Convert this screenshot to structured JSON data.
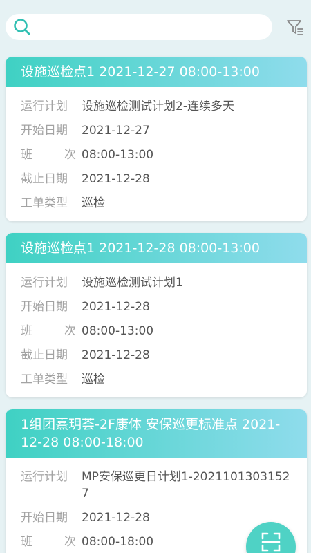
{
  "search": {
    "placeholder": "",
    "value": ""
  },
  "icons": {
    "search": "search-icon",
    "filter": "filter-icon",
    "scan": "scan-icon"
  },
  "colors": {
    "accent": "#3fd1c3",
    "accent_light": "#8fdcec",
    "background": "#e6f2f4"
  },
  "labels": {
    "plan": "运行计划",
    "start_date": "开始日期",
    "shift_a": "班",
    "shift_b": "次",
    "end_date": "截止日期",
    "order_type": "工单类型"
  },
  "cards": [
    {
      "title": "设施巡检点1 2021-12-27 08:00-13:00",
      "plan": "设施巡检测试计划2-连续多天",
      "start_date": "2021-12-27",
      "shift": "08:00-13:00",
      "end_date": "2021-12-28",
      "order_type": "巡检"
    },
    {
      "title": "设施巡检点1 2021-12-28 08:00-13:00",
      "plan": "设施巡检测试计划1",
      "start_date": "2021-12-28",
      "shift": "08:00-13:00",
      "end_date": "2021-12-28",
      "order_type": "巡检"
    },
    {
      "title": "1组团熹玥荟-2F康体 安保巡更标准点 2021-12-28 08:00-18:00",
      "plan": "MP安保巡更日计划1-20211013031527",
      "start_date": "2021-12-28",
      "shift": "08:00-18:00",
      "end_date": "",
      "order_type": ""
    }
  ]
}
